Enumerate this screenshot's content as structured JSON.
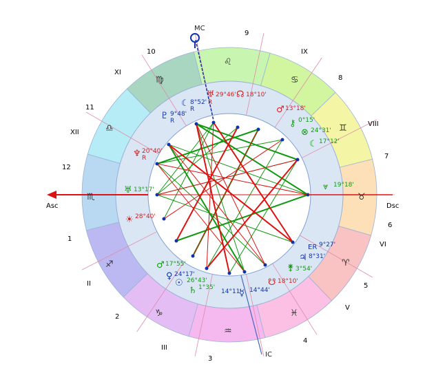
{
  "axes": {
    "mc_label": "MC",
    "ic_label": "IC",
    "asc_label": "Asc",
    "dsc_label": "Dsc"
  },
  "house_numbers": {
    "arabic": [
      "1",
      "2",
      "3",
      "4",
      "5",
      "6",
      "7",
      "8",
      "9",
      "10",
      "11",
      "12"
    ],
    "roman": [
      "I",
      "II",
      "III",
      "IV",
      "V",
      "VI",
      "VII",
      "VIII",
      "IX",
      "X",
      "XI",
      "XII"
    ]
  },
  "signs": {
    "leo": "♌",
    "cancer": "♋",
    "gemini": "♊",
    "taurus": "♉",
    "aries": "♈",
    "pisces": "♓",
    "aquarius": "♒",
    "capricorn": "♑",
    "sagittarius": "♐",
    "scorpio": "♏",
    "libra": "♎",
    "virgo": "♍"
  },
  "planets": {
    "uranus_glyph": "♅",
    "uranus_deg": "29°46'",
    "uranus_r": "R",
    "node_n_glyph": "☊",
    "node_n_deg": "18°10'",
    "moon_glyph": "☾",
    "moon_deg": "8°52'",
    "moon_r": "R",
    "pluto_glyph": "♇",
    "pluto_deg": "9°48'",
    "pluto_r": "R",
    "mars_glyph": "♂",
    "mars_deg": "13°18'",
    "chiron_glyph": "⚷",
    "chiron_deg": "0°15'",
    "fortune_glyph": "⊗",
    "fortune_deg": "24°31'",
    "lilith_glyph": "☾",
    "lilith_deg": "17°12'",
    "neptune_glyph": "♆",
    "neptune_deg": "20°40'",
    "neptune_r": "R",
    "asc_uranus_glyph": "♅",
    "asc_uranus_deg": "13°17'",
    "sun_small_glyph": "☀",
    "sun_small_deg": "28°40'",
    "vertex_glyph": "⩔",
    "vertex_deg": "19°18'",
    "er_glyph": "ER",
    "er_deg": "9°27'",
    "jupiter_glyph": "♃",
    "jupiter_deg": "8°31'",
    "juno_glyph": "⚵",
    "juno_deg": "3°54'",
    "node_s_glyph": "☋",
    "node_s_deg": "18°10'",
    "mars2_glyph": "♂",
    "mars2_deg": "17°55'",
    "venus_glyph": "♀",
    "venus_deg": "24°17'",
    "sun_glyph": "☉",
    "sun_deg": "26°43'",
    "saturn_glyph": "♄",
    "saturn_deg": "1°35'",
    "mercury_glyph": "☿",
    "mercury_deg_left": "14°11'",
    "mercury_deg_right": "14°44'"
  },
  "colors": {
    "leo": "#c8f5b0",
    "cancer": "#d2f5a0",
    "gemini": "#f4f6a6",
    "taurus": "#fde0b8",
    "aries": "#f9c3c3",
    "pisces": "#fbc0e4",
    "aquarius": "#f5b9f0",
    "capricorn": "#e4bdf5",
    "sagittarius": "#bcb8f2",
    "scorpio": "#b9d8f2",
    "libra": "#b5ecf5",
    "virgo": "#a8d6c0",
    "inner_ring": "#dbe6f5",
    "red_aspect": "#dd1111",
    "green_aspect": "#119911",
    "blue_axis": "#1133aa"
  }
}
